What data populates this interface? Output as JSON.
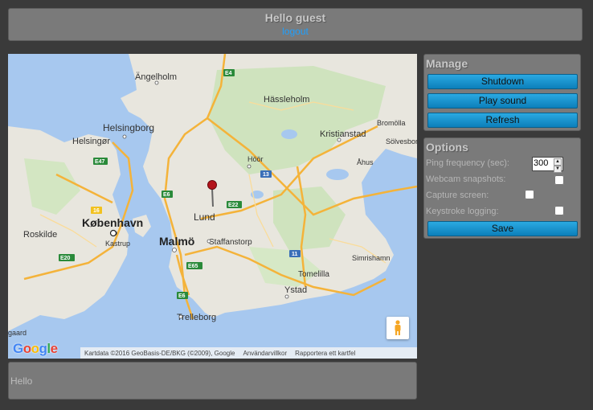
{
  "header": {
    "greeting": "Hello guest",
    "logout_label": "logout"
  },
  "map": {
    "cities": {
      "angelholm": "Ängelholm",
      "hassleholm": "Hässleholm",
      "helsingborg": "Helsingborg",
      "helsingor": "Helsingør",
      "kristianstad": "Kristianstad",
      "bromolla": "Bromölla",
      "solvesborg": "Sölvesborg",
      "hoor": "Höör",
      "ahus": "Åhus",
      "lund": "Lund",
      "kobenhavn": "København",
      "roskilde": "Roskilde",
      "kastrup": "Kastrup",
      "malmo": "Malmö",
      "staffanstorp": "Staffanstorp",
      "simrishamn": "Simrishamn",
      "tomelilla": "Tomelilla",
      "ystad": "Ystad",
      "trelleborg": "Trelleborg",
      "gaard": "gaard"
    },
    "roads": {
      "e4": "E4",
      "e47": "E47",
      "e6a": "E6",
      "e6b": "E6",
      "e22": "E22",
      "r13": "13",
      "r11": "11",
      "r16": "16",
      "e65": "E65",
      "e20": "E20"
    },
    "footer": {
      "attribution": "Kartdata ©2016 GeoBasis-DE/BKG (©2009), Google",
      "terms": "Användarvillkor",
      "report": "Rapportera ett kartfel"
    },
    "logo": "Google",
    "colors": {
      "water": "#a7c8ef",
      "land": "#e8e6de",
      "road": "#f4b33a",
      "marker": "#b3131b"
    }
  },
  "manage": {
    "title": "Manage",
    "shutdown_label": "Shutdown",
    "play_sound_label": "Play sound",
    "refresh_label": "Refresh"
  },
  "options": {
    "title": "Options",
    "ping_label": "Ping frequency (sec):",
    "ping_value": "300",
    "webcam_label": "Webcam snapshots:",
    "capture_label": "Capture screen:",
    "keystroke_label": "Keystroke logging:",
    "save_label": "Save"
  },
  "bottom": {
    "text": "Hello"
  },
  "theme": {
    "accent": "#1ea0ff",
    "button": "#1a93cf",
    "panel": "#7a7a7a",
    "background": "#3a3a3a"
  }
}
